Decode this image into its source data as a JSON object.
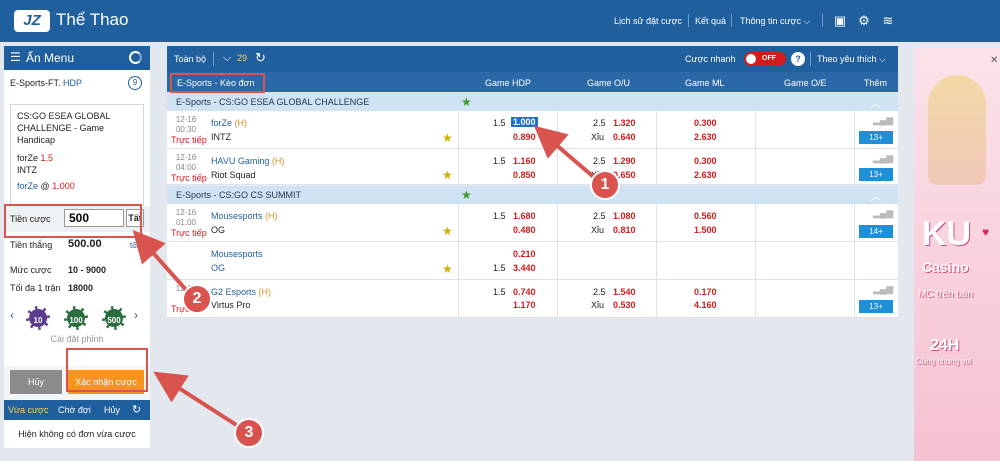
{
  "app": {
    "logo": "JZ",
    "title": "Thể Thao"
  },
  "topnav": {
    "history": "Lịch sử đặt cược",
    "results": "Kết quả",
    "bet_info": "Thông tin cược"
  },
  "left": {
    "hide_menu": "Ẩn Menu",
    "market_prefix": "E-Sports-FT.",
    "market_type": "HDP",
    "count": "9",
    "slip": {
      "game": "CS:GO ESEA GLOBAL CHALLENGE - Game Handicap",
      "home": "forZe",
      "home_line": "1.5",
      "away": "INTZ",
      "pick_team": "forZe",
      "pick_at": "@",
      "pick_odds": "1.000"
    },
    "stake_label": "Tiền cược",
    "stake_value": "500",
    "stake_all": "Tất",
    "win_label": "Tiền thắng",
    "win_value": "500.00",
    "min_hint": "tối",
    "limit_label": "Mức cược",
    "limit_value": "10 - 9000",
    "max_label": "Tối đa 1 trận",
    "max_value": "18000",
    "chips": [
      "10",
      "100",
      "500"
    ],
    "chip_settings": "Cài đặt phỉnh",
    "cancel": "Hủy",
    "confirm": "Xác nhận cược",
    "tabs": [
      "Vừa cược",
      "Chờ đợi",
      "Hủy"
    ],
    "empty": "Hiện không có đơn vừa cược"
  },
  "toolbar": {
    "all": "Toàn bộ",
    "count": "29",
    "quick": "Cược nhanh",
    "toggle": "OFF",
    "help": "?",
    "sort": "Theo yêu thích"
  },
  "table_header": {
    "market": "E-Sports - Kèo đơn",
    "hdp": "Game HDP",
    "ou": "Game O/U",
    "ml": "Game ML",
    "oe": "Game O/E",
    "more": "Thêm"
  },
  "leagues": [
    {
      "name": "E-Sports - CS:GO ESEA GLOBAL CHALLENGE",
      "matches": [
        {
          "date": "12-16",
          "time": "00:30",
          "live": "Trực tiếp",
          "home": "forZe",
          "home_tag": "(H)",
          "away": "INTZ",
          "hdp_line": "1.5",
          "hdp_home": "1.000",
          "hdp_away": "0.890",
          "ou_line": "2.5",
          "ou_over": "1.320",
          "ou_under_label": "Xỉu",
          "ou_under": "0.640",
          "ml_home": "0.300",
          "ml_away": "2.630",
          "more": "13+"
        },
        {
          "date": "12-16",
          "time": "04:00",
          "live": "Trực tiếp",
          "home": "HAVU Gaming",
          "home_tag": "(H)",
          "away": "Riot Squad",
          "hdp_line": "1.5",
          "hdp_home": "1.160",
          "hdp_away": "0.850",
          "ou_line": "2.5",
          "ou_over": "1.290",
          "ou_under_label": "Xỉu",
          "ou_under": "0.650",
          "ml_home": "0.300",
          "ml_away": "2.630",
          "more": "13+"
        }
      ]
    },
    {
      "name": "E-Sports - CS:GO CS SUMMIT",
      "matches": [
        {
          "date": "12-16",
          "time": "01:00",
          "live": "Trực tiếp",
          "home": "Mousesports",
          "home_tag": "(H)",
          "away": "OG",
          "hdp_line": "1.5",
          "hdp_home": "1.680",
          "hdp_away": "0.480",
          "ou_line": "2.5",
          "ou_over": "1.080",
          "ou_under_label": "Xỉu",
          "ou_under": "0.810",
          "ml_home": "0.560",
          "ml_away": "1.500",
          "more": "14+"
        },
        {
          "date": "",
          "time": "",
          "live": "",
          "home": "Mousesports",
          "home_tag": "",
          "away": "OG",
          "hdp_line": "1.5",
          "hdp_home": "0.210",
          "hdp_away": "3.440",
          "ou_line": "",
          "ou_over": "",
          "ou_under_label": "",
          "ou_under": "",
          "ml_home": "",
          "ml_away": "",
          "more": ""
        },
        {
          "date": "12-16",
          "time": "",
          "live": "Trực",
          "home": "G2 Esports",
          "home_tag": "(H)",
          "away": "Virtus Pro",
          "hdp_line": "1.5",
          "hdp_home": "0.740",
          "hdp_away": "1.170",
          "ou_line": "2.5",
          "ou_over": "1.540",
          "ou_under_label": "Xỉu",
          "ou_under": "0.530",
          "ml_home": "0.170",
          "ml_away": "4.160",
          "more": "13+"
        }
      ]
    }
  ],
  "ad": {
    "ku": "KU",
    "casino": "Casino",
    "mc": "MC trên bàn",
    "hours": "24H",
    "sub": "Cùng chung vui"
  },
  "callouts": [
    "1",
    "2",
    "3"
  ],
  "colors": {
    "primary": "#1f5f9e",
    "odds_red": "#d21b1b",
    "confirm_orange": "#f7941d",
    "callout_red": "#d9534f"
  }
}
